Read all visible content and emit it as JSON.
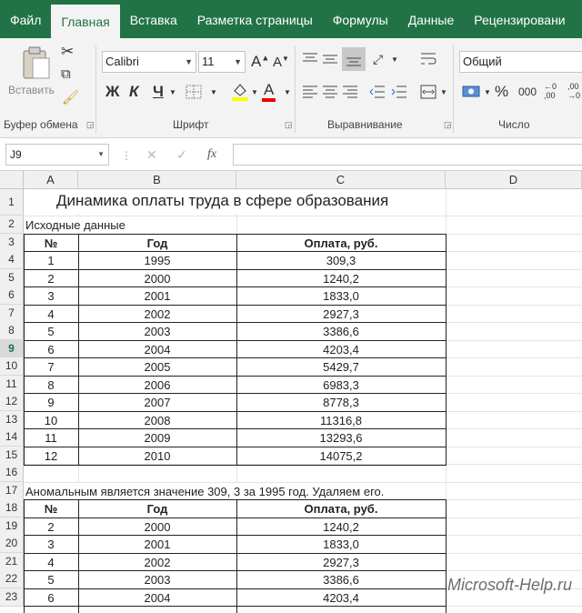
{
  "tabs": [
    "Файл",
    "Главная",
    "Вставка",
    "Разметка страницы",
    "Формулы",
    "Данные",
    "Рецензировани"
  ],
  "ribbon": {
    "paste_label": "Вставить",
    "font_name": "Calibri",
    "font_size": "11",
    "grow_font": "A",
    "shrink_font": "A",
    "bold": "Ж",
    "italic": "К",
    "underline": "Ч",
    "font_color": "A",
    "number_format": "Общий",
    "percent": "%",
    "comma": "000",
    "groups": {
      "clipboard": "Буфер обмена",
      "font": "Шрифт",
      "alignment": "Выравнивание",
      "number": "Число"
    }
  },
  "formula_bar": {
    "name_box": "J9",
    "fx": "fx",
    "cancel": "✕",
    "enter": "✓"
  },
  "columns": [
    "A",
    "B",
    "C",
    "D"
  ],
  "rows": [
    "1",
    "2",
    "3",
    "4",
    "5",
    "6",
    "7",
    "8",
    "9",
    "10",
    "11",
    "12",
    "13",
    "14",
    "15",
    "16",
    "17",
    "18",
    "19",
    "20",
    "21",
    "22",
    "23"
  ],
  "sheet": {
    "title": "Динамика оплаты труда в сфере образования",
    "source_label": "Исходные данные",
    "headers": [
      "№",
      "Год",
      "Оплата, руб."
    ],
    "table1": [
      [
        "1",
        "1995",
        "309,3"
      ],
      [
        "2",
        "2000",
        "1240,2"
      ],
      [
        "3",
        "2001",
        "1833,0"
      ],
      [
        "4",
        "2002",
        "2927,3"
      ],
      [
        "5",
        "2003",
        "3386,6"
      ],
      [
        "6",
        "2004",
        "4203,4"
      ],
      [
        "7",
        "2005",
        "5429,7"
      ],
      [
        "8",
        "2006",
        "6983,3"
      ],
      [
        "9",
        "2007",
        "8778,3"
      ],
      [
        "10",
        "2008",
        "11316,8"
      ],
      [
        "11",
        "2009",
        "13293,6"
      ],
      [
        "12",
        "2010",
        "14075,2"
      ]
    ],
    "anomaly_note": "Аномальным является значение 309, 3 за 1995 год. Удаляем его.",
    "table2": [
      [
        "2",
        "2000",
        "1240,2"
      ],
      [
        "3",
        "2001",
        "1833,0"
      ],
      [
        "4",
        "2002",
        "2927,3"
      ],
      [
        "5",
        "2003",
        "3386,6"
      ],
      [
        "6",
        "2004",
        "4203,4"
      ]
    ]
  },
  "watermark": "Microsoft-Help.ru",
  "colors": {
    "accent": "#217346",
    "ribbon_bg": "#f3f3f3"
  }
}
